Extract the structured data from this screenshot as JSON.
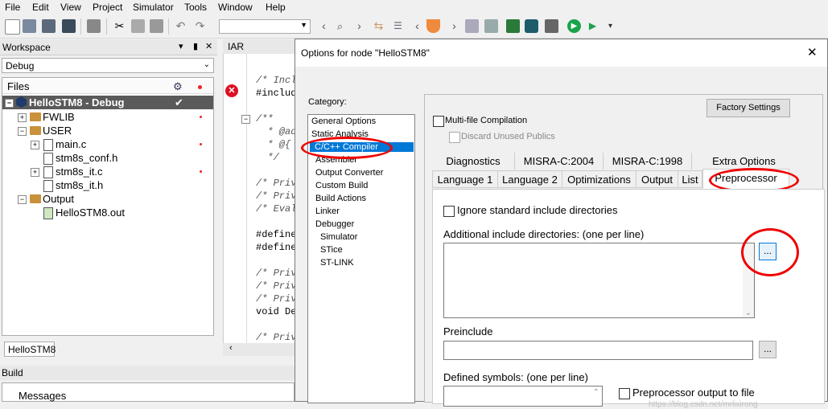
{
  "menubar": [
    "File",
    "Edit",
    "View",
    "Project",
    "Simulator",
    "Tools",
    "Window",
    "Help"
  ],
  "workspace": {
    "title": "Workspace",
    "pin": "▾",
    "close": "✕",
    "config": "Debug",
    "files_header": "Files",
    "project": "HelloSTM8 - Debug",
    "tree": [
      "FWLIB",
      "USER",
      "main.c",
      "stm8s_conf.h",
      "stm8s_it.c",
      "stm8s_it.h",
      "Output",
      "HelloSTM8.out"
    ],
    "tab": "HelloSTM8"
  },
  "editor": {
    "tab": "IAR Information",
    "lines": [
      "/* Incl",
      "#includ",
      "/**",
      "  * @ad",
      "  * @{",
      "  */",
      "/* Priv",
      "/* Priv",
      "/* Eval",
      "#define",
      "#define",
      "/* Priv",
      "/* Priv",
      "/* Priv",
      "void De",
      "/* Priv"
    ]
  },
  "build": {
    "title": "Build",
    "messages": "Messages"
  },
  "dialog": {
    "title": "Options for node \"HelloSTM8\"",
    "close": "✕",
    "category_label": "Category:",
    "categories": [
      "General Options",
      "Static Analysis",
      "C/C++ Compiler",
      "Assembler",
      "Output Converter",
      "Custom Build",
      "Build Actions",
      "Linker",
      "Debugger",
      "Simulator",
      "STice",
      "ST-LINK"
    ],
    "factory": "Factory Settings",
    "multifile": "Multi-file Compilation",
    "discard": "Discard Unused Publics",
    "tabs_row1": [
      "Diagnostics",
      "MISRA-C:2004",
      "MISRA-C:1998",
      "Extra Options"
    ],
    "tabs_row2": [
      "Language 1",
      "Language 2",
      "Optimizations",
      "Output",
      "List",
      "Preprocessor"
    ],
    "ignore_std": "Ignore standard include directories",
    "add_include_label": "Additional include directories: (one per line)",
    "browse": "...",
    "preinclude_label": "Preinclude",
    "defined_label": "Defined symbols: (one per line)",
    "pp_output": "Preprocessor output to file",
    "watermark": "https://blog.csdn.net/mrlixirong"
  },
  "colors": {
    "highlight": "#0078d7",
    "annotation": "#e00000",
    "project_bar": "#5a5a5a"
  }
}
